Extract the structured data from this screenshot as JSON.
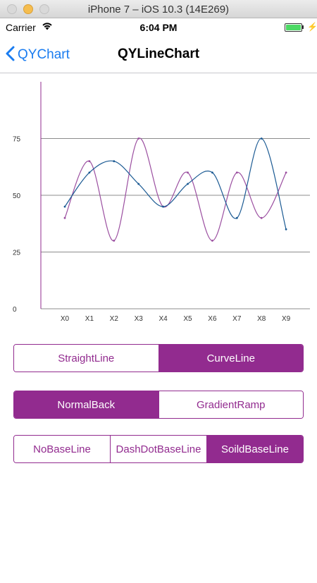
{
  "window": {
    "title": "iPhone 7 – iOS 10.3 (14E269)"
  },
  "status": {
    "carrier": "Carrier",
    "time": "6:04 PM",
    "battery_level": 1.0
  },
  "nav": {
    "back_label": "QYChart",
    "title": "QYLineChart",
    "back_icon": "chevron-left-icon"
  },
  "colors": {
    "accent": "#922b8f",
    "line_purple": "#9b4fa0",
    "line_blue": "#1b5a93",
    "tint": "#1a7cf0"
  },
  "chart_data": {
    "type": "line",
    "categories": [
      "X0",
      "X1",
      "X2",
      "X3",
      "X4",
      "X5",
      "X6",
      "X7",
      "X8",
      "X9"
    ],
    "series": [
      {
        "color": "#9b4fa0",
        "values": [
          40,
          65,
          30,
          75,
          45,
          60,
          30,
          60,
          40,
          60
        ]
      },
      {
        "color": "#1b5a93",
        "values": [
          45,
          60,
          65,
          55,
          45,
          55,
          60,
          40,
          75,
          35
        ]
      }
    ],
    "yticks": [
      0,
      25,
      50,
      75
    ],
    "ylim": [
      0,
      100
    ],
    "baseline_style": "solid",
    "curve": true
  },
  "controls": {
    "line_style": {
      "items": [
        "StraightLine",
        "CurveLine"
      ],
      "selected": 1
    },
    "background": {
      "items": [
        "NormalBack",
        "GradientRamp"
      ],
      "selected": 0
    },
    "baseline": {
      "items": [
        "NoBaseLine",
        "DashDotBaseLine",
        "SoildBaseLine"
      ],
      "selected": 2
    }
  }
}
